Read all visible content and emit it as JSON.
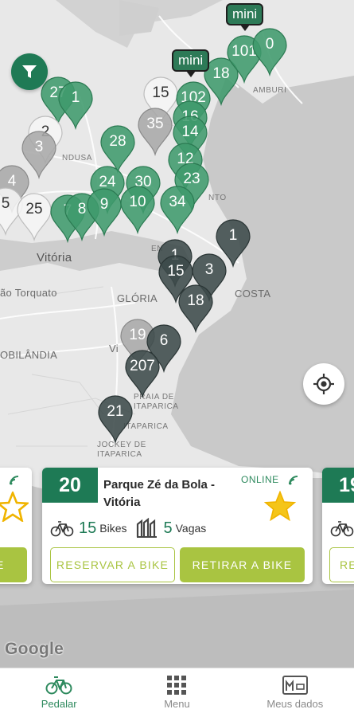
{
  "map": {
    "places": [
      {
        "id": "vitoria",
        "text": "Vitória"
      },
      {
        "id": "rio-torquato",
        "text": "ão Torquato"
      },
      {
        "id": "gloria",
        "text": "GLÓRIA"
      },
      {
        "id": "costa",
        "text": "COSTA"
      },
      {
        "id": "obilandia",
        "text": "OBILÂNDIA"
      },
      {
        "id": "vi",
        "text": "Vi"
      },
      {
        "id": "praia-itaparica",
        "text": "PRAIA DE\nITAPARICA"
      },
      {
        "id": "jockey",
        "text": "JOCKEY DE\nITAPARICA"
      },
      {
        "id": "ndusa",
        "text": "NDUSA"
      },
      {
        "id": "nto",
        "text": "NTO"
      },
      {
        "id": "en",
        "text": "EN"
      },
      {
        "id": "cambur",
        "text": "AMBURI"
      },
      {
        "id": "itaparica-small",
        "text": "ITAPARICA"
      }
    ],
    "markers": [
      {
        "label": "27"
      },
      {
        "label": "1"
      },
      {
        "label": "2"
      },
      {
        "label": "3"
      },
      {
        "label": "15"
      },
      {
        "label": "102"
      },
      {
        "label": "16"
      },
      {
        "label": "18"
      },
      {
        "label": "101"
      },
      {
        "label": "0"
      },
      {
        "label": "35"
      },
      {
        "label": "14"
      },
      {
        "label": "28"
      },
      {
        "label": "12"
      },
      {
        "label": "23"
      },
      {
        "label": "24"
      },
      {
        "label": "30"
      },
      {
        "label": "4"
      },
      {
        "label": "5"
      },
      {
        "label": "25"
      },
      {
        "label": "7"
      },
      {
        "label": "8"
      },
      {
        "label": "9"
      },
      {
        "label": "10"
      },
      {
        "label": "34"
      },
      {
        "label": "1"
      },
      {
        "label": "1"
      },
      {
        "label": "15"
      },
      {
        "label": "3"
      },
      {
        "label": "18"
      },
      {
        "label": "19"
      },
      {
        "label": "6"
      },
      {
        "label": "207"
      },
      {
        "label": "21"
      }
    ],
    "mini_tags": [
      "mini",
      "mini"
    ],
    "google_logo": "Google",
    "icons": {
      "filter": "filter-icon",
      "locate": "crosshair-icon"
    }
  },
  "cards": {
    "main": {
      "id_number": "20",
      "name": "Parque Zé da Bola - Vitória",
      "status": "ONLINE",
      "bikes_count": "15",
      "bikes_label": "Bikes",
      "vagas_count": "5",
      "vagas_label": "Vagas",
      "reserve_button": "RESERVAR A BIKE",
      "take_button": "RETIRAR A BIKE",
      "favorite": true
    },
    "left_partial": {
      "button_text": "KE"
    },
    "right_partial": {
      "id_number": "19",
      "button_text": "RE"
    }
  },
  "bottom_nav": {
    "items": [
      {
        "label": "Pedalar",
        "icon": "bike-icon",
        "active": true
      },
      {
        "label": "Menu",
        "icon": "grid-icon",
        "active": false
      },
      {
        "label": "Meus dados",
        "icon": "id-card-icon",
        "active": false
      }
    ]
  },
  "colors": {
    "brand_green": "#1e7a55",
    "accent_lime": "#a9c441",
    "star_yellow": "#f5c518",
    "marker_light": "#4da87a",
    "marker_dark": "#3f4d4d"
  }
}
